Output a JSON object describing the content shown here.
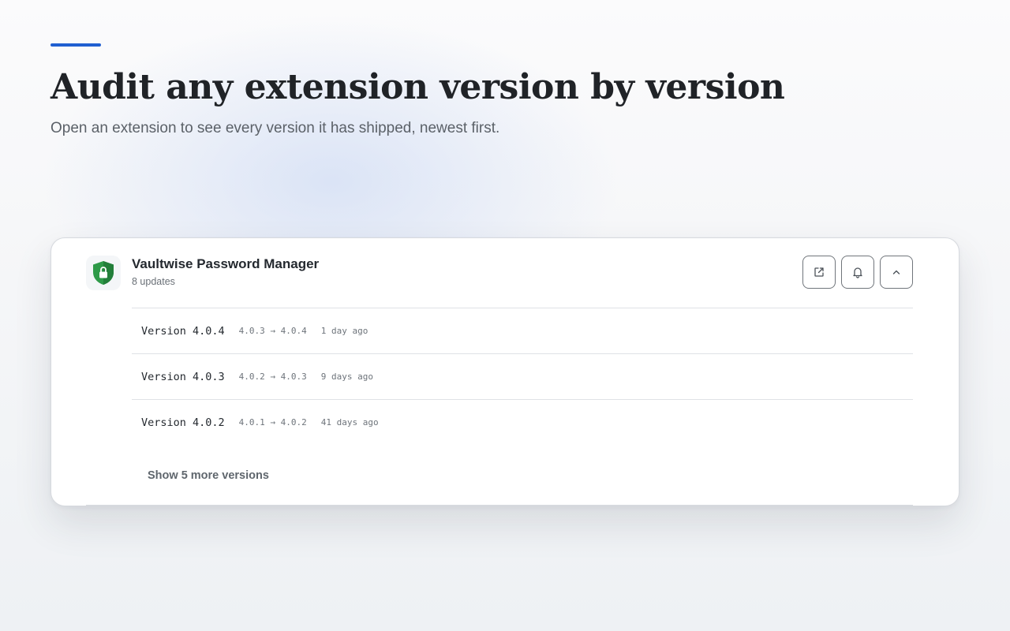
{
  "hero": {
    "title": "Audit any extension version by version",
    "subtitle": "Open an extension to see every version it has shipped, newest first.",
    "accent_color": "#1f5fd1"
  },
  "extension": {
    "name": "Vaultwise Password Manager",
    "updates_label": "8 updates",
    "logo_icon": "green-shield-lock-icon",
    "logo_color": "#2e9a48",
    "actions": [
      {
        "name": "open-external-button",
        "icon": "external-link-icon"
      },
      {
        "name": "notify-button",
        "icon": "bell-icon"
      },
      {
        "name": "collapse-button",
        "icon": "chevron-up-icon"
      }
    ],
    "versions": [
      {
        "label": "Version 4.0.4",
        "range": "4.0.3 → 4.0.4",
        "age": "1 day ago"
      },
      {
        "label": "Version 4.0.3",
        "range": "4.0.2 → 4.0.3",
        "age": "9 days ago"
      },
      {
        "label": "Version 4.0.2",
        "range": "4.0.1 → 4.0.2",
        "age": "41 days ago"
      }
    ],
    "show_more_label": "Show 5 more versions"
  }
}
